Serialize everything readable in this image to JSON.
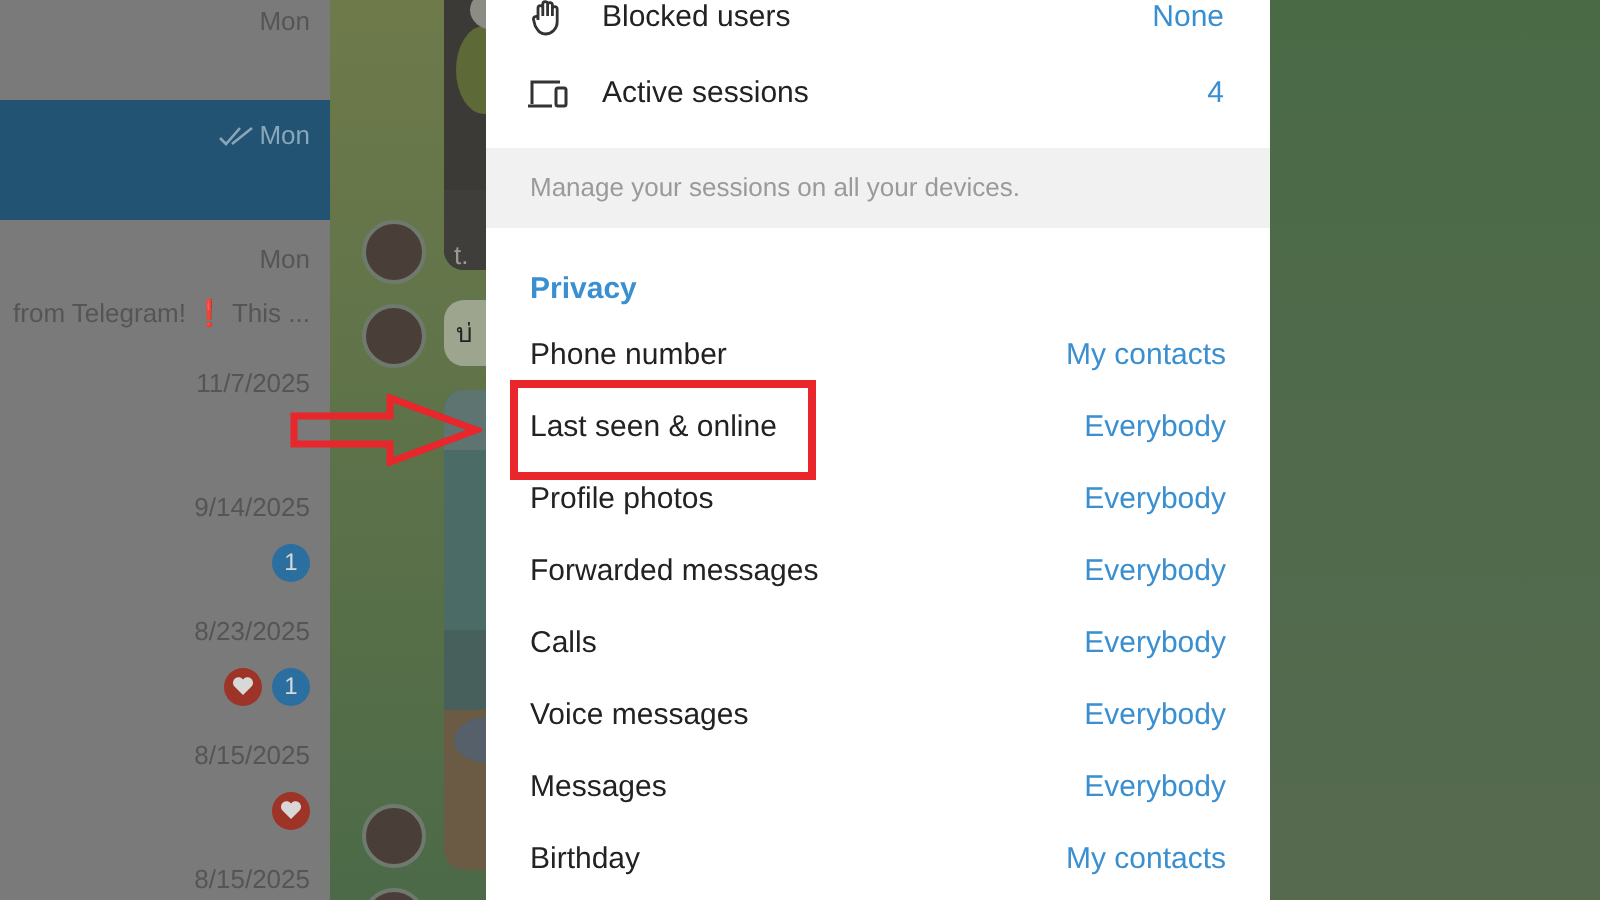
{
  "chat_list": [
    {
      "time": "Mon",
      "selected": false,
      "read": false
    },
    {
      "time": "Mon",
      "selected": true,
      "read": true
    },
    {
      "time": "Mon",
      "selected": false,
      "read": false,
      "preview": "from Telegram! ❗ This ..."
    },
    {
      "time": "11/7/2025",
      "selected": false,
      "read": false
    },
    {
      "time": "9/14/2025",
      "selected": false,
      "read": false,
      "badges": [
        {
          "kind": "count",
          "text": "1"
        }
      ]
    },
    {
      "time": "8/23/2025",
      "selected": false,
      "read": false,
      "badges": [
        {
          "kind": "reaction"
        },
        {
          "kind": "count",
          "text": "1"
        }
      ]
    },
    {
      "time": "8/15/2025",
      "selected": false,
      "read": false,
      "badges": [
        {
          "kind": "reaction"
        }
      ]
    },
    {
      "time": "8/15/2025",
      "selected": false,
      "read": false
    }
  ],
  "chat": {
    "link_caption": "t.",
    "message": "บ่"
  },
  "settings": {
    "security_rows": [
      {
        "label": "Blocked users",
        "value": "None"
      },
      {
        "label": "Active sessions",
        "value": "4"
      }
    ],
    "security_note": "Manage your sessions on all your devices.",
    "privacy_header": "Privacy",
    "privacy_rows": [
      {
        "label": "Phone number",
        "value": "My contacts",
        "highlighted": false
      },
      {
        "label": "Last seen & online",
        "value": "Everybody",
        "highlighted": true
      },
      {
        "label": "Profile photos",
        "value": "Everybody",
        "highlighted": false
      },
      {
        "label": "Forwarded messages",
        "value": "Everybody",
        "highlighted": false
      },
      {
        "label": "Calls",
        "value": "Everybody",
        "highlighted": false
      },
      {
        "label": "Voice messages",
        "value": "Everybody",
        "highlighted": false
      },
      {
        "label": "Messages",
        "value": "Everybody",
        "highlighted": false
      },
      {
        "label": "Birthday",
        "value": "My contacts",
        "highlighted": false
      }
    ]
  }
}
